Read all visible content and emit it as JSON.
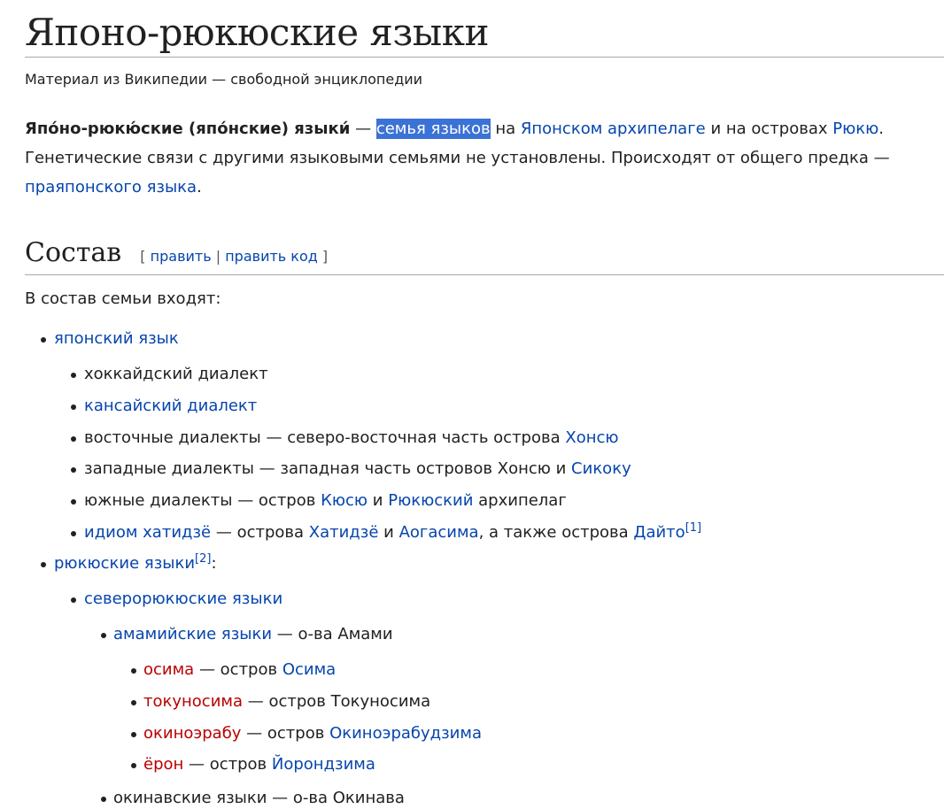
{
  "title": "Японо-рюкюские языки",
  "tagline": "Материал из Википедии — свободной энциклопедии",
  "intro": {
    "bold_term": "Япо́но-рюкю́ские (япо́нские) языки́",
    "dash1": " — ",
    "link_family": "семья языков",
    "text_na": " на ",
    "link_archipelago": "Японском архипелаге",
    "text_islands": " и на островах ",
    "link_ryukyu": "Рюкю",
    "text_dot": ".",
    "sentence2": "Генетические связи с другими языковыми семьями не установлены. Происходят от общего предка —",
    "link_proto": "праяпонского языка",
    "text_end": "."
  },
  "section": {
    "title": "Состав",
    "bracket_open": "[",
    "edit": "править",
    "sep": "|",
    "edit_source": "править код",
    "bracket_close": "]"
  },
  "lead": "В состав семьи входят:",
  "tree": {
    "japanese": {
      "link": "японский язык"
    },
    "hokkaido": {
      "text": "хоккайдский диалект"
    },
    "kansai": {
      "link": "кансайский диалект"
    },
    "eastern": {
      "text": "восточные диалекты — северо-восточная часть острова ",
      "link": "Хонсю"
    },
    "western": {
      "text": "западные диалекты — западная часть островов Хонсю и ",
      "link": "Сикоку"
    },
    "southern": {
      "text1": "южные диалекты — остров ",
      "link1": "Кюсю",
      "text2": " и ",
      "link2": "Рюкюский",
      "text3": " архипелаг"
    },
    "hachijo": {
      "link1": "идиом хатидзё",
      "text1": " — острова ",
      "link2": "Хатидзё",
      "text2": " и ",
      "link3": "Аогасима",
      "text3": ", а также острова ",
      "link4": "Дайто",
      "ref": "[1]"
    },
    "ryukyuan": {
      "link": "рюкюские языки",
      "ref": "[2]",
      "colon": ":"
    },
    "northern": {
      "link": "северорюкюские языки"
    },
    "amami": {
      "link": "амамийские языки",
      "text": " — о-ва Амами"
    },
    "osima": {
      "link": "осима",
      "text": " — остров ",
      "link2": "Осима"
    },
    "tokunosima": {
      "link": "токуносима",
      "text": " — остров Токуносима"
    },
    "okinoerabu": {
      "link": "окиноэрабу",
      "text": " — остров ",
      "link2": "Окиноэрабудзима"
    },
    "yoron": {
      "link": "ёрон",
      "text": " — остров ",
      "link2": "Йорондзима"
    },
    "okinawan": {
      "text": "окинавские языки — о-ва Окинава"
    }
  },
  "colors": {
    "link": "#0645ad",
    "redlink": "#ba0000",
    "text": "#202122",
    "highlight": "#3b72d6"
  }
}
